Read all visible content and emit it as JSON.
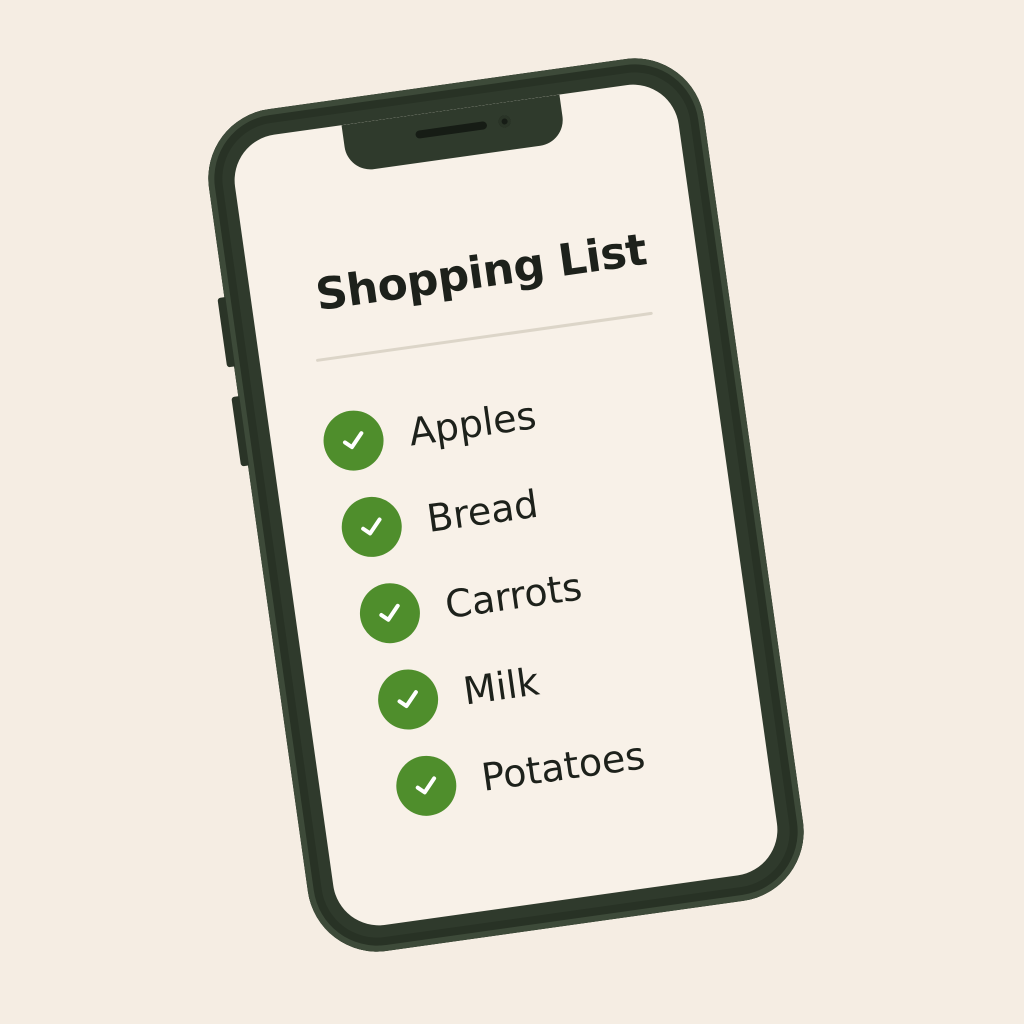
{
  "app": {
    "title": "Shopping List"
  },
  "items": [
    {
      "label": "Apples",
      "checked": true
    },
    {
      "label": "Bread",
      "checked": true
    },
    {
      "label": "Carrots",
      "checked": true
    },
    {
      "label": "Milk",
      "checked": true
    },
    {
      "label": "Potatoes",
      "checked": true
    }
  ],
  "icons": {
    "item_check": "check-circle-icon"
  },
  "colors": {
    "background": "#f5ede3",
    "phone_frame": "#2f3a2c",
    "screen": "#f8f1e8",
    "check_fill": "#4f8e2c",
    "text": "#1d211b"
  }
}
